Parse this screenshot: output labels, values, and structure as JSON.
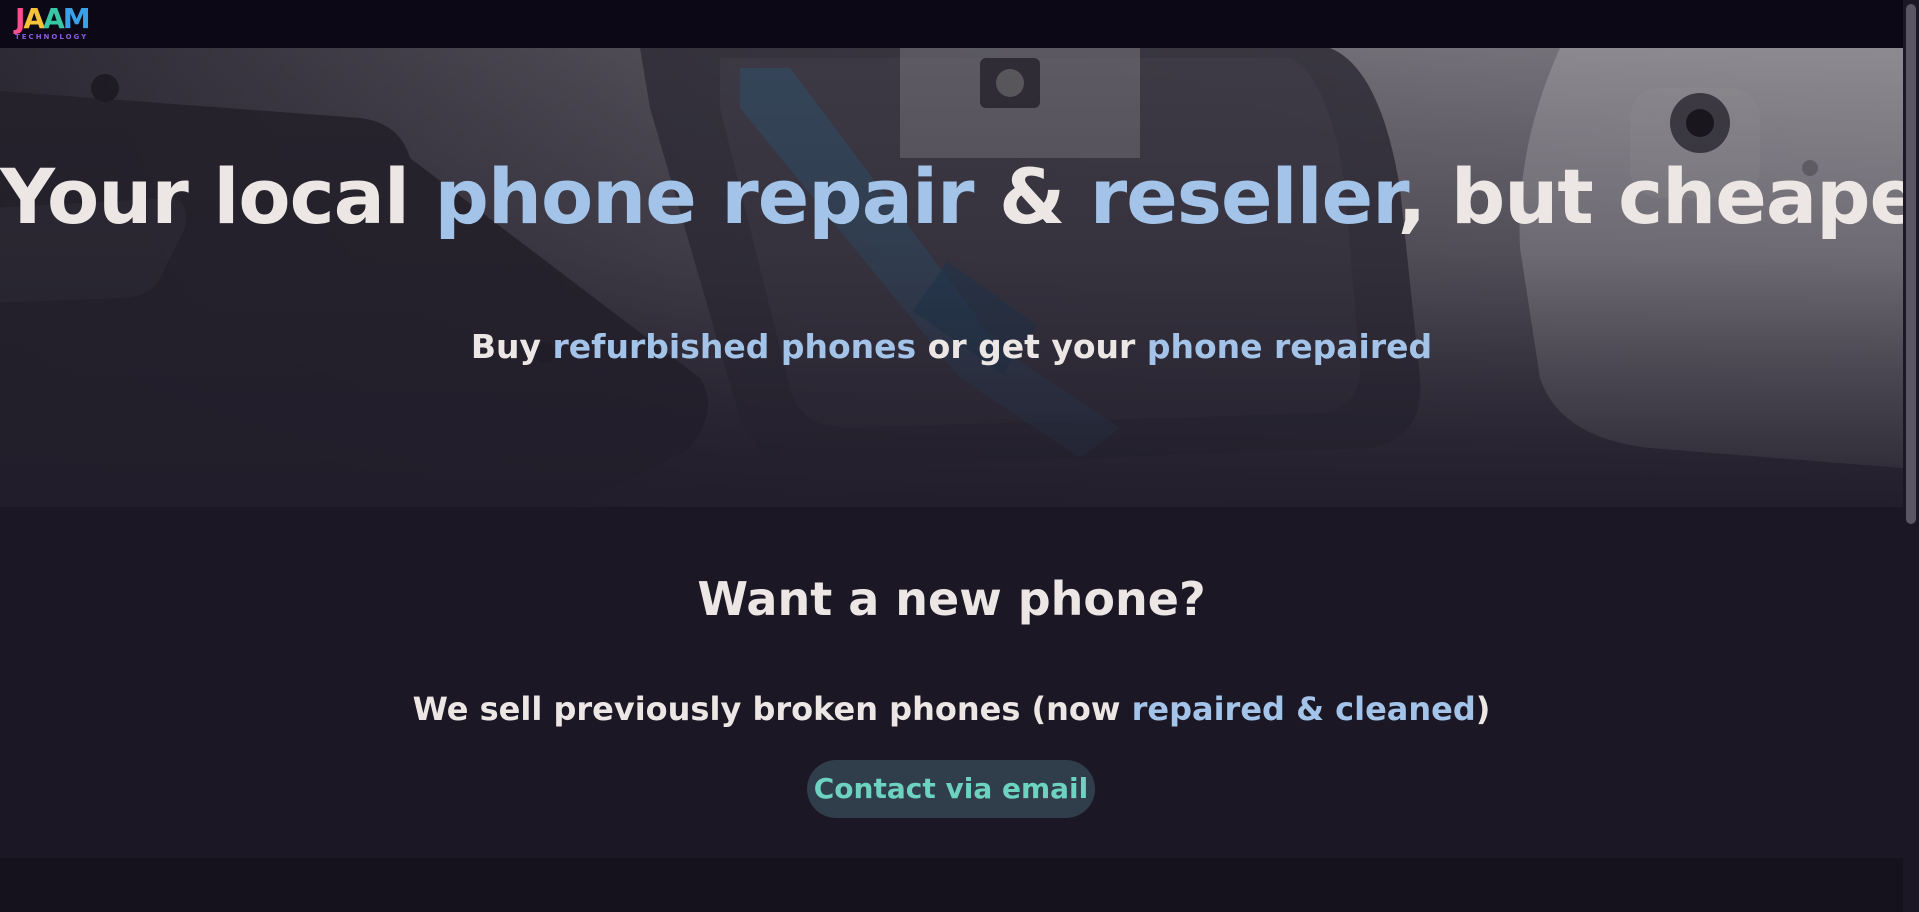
{
  "brand": {
    "letters": [
      {
        "char": "J",
        "color": "#ff4d8d"
      },
      {
        "char": "A",
        "color": "#f5c23a"
      },
      {
        "char": "A",
        "color": "#38c7a6"
      },
      {
        "char": "M",
        "color": "#3aa0e8"
      }
    ],
    "subtitle": "TECHNOLOGY"
  },
  "hero": {
    "title_parts": [
      {
        "text": "Your local ",
        "highlight": false
      },
      {
        "text": "phone repair",
        "highlight": true
      },
      {
        "text": " & ",
        "highlight": false
      },
      {
        "text": "reseller",
        "highlight": true
      },
      {
        "text": ", but cheaper",
        "highlight": false
      }
    ],
    "subtitle_parts": [
      {
        "text": "Buy ",
        "highlight": false
      },
      {
        "text": "refurbished phones",
        "highlight": true
      },
      {
        "text": " or get your ",
        "highlight": false
      },
      {
        "text": "phone repaired",
        "highlight": true
      }
    ]
  },
  "sell_section": {
    "title": "Want a new phone?",
    "text_parts": [
      {
        "text": "We sell previously broken phones (now ",
        "highlight": false
      },
      {
        "text": "repaired & cleaned",
        "highlight": true
      },
      {
        "text": ")",
        "highlight": false
      }
    ],
    "button_label": "Contact via email"
  },
  "colors": {
    "accent": "#a3c4e8",
    "button_text": "#6dd3c0",
    "button_bg": "#2f3e4a",
    "text": "#ece7e4",
    "background": "#1b1724",
    "navbar": "#0c0815"
  }
}
